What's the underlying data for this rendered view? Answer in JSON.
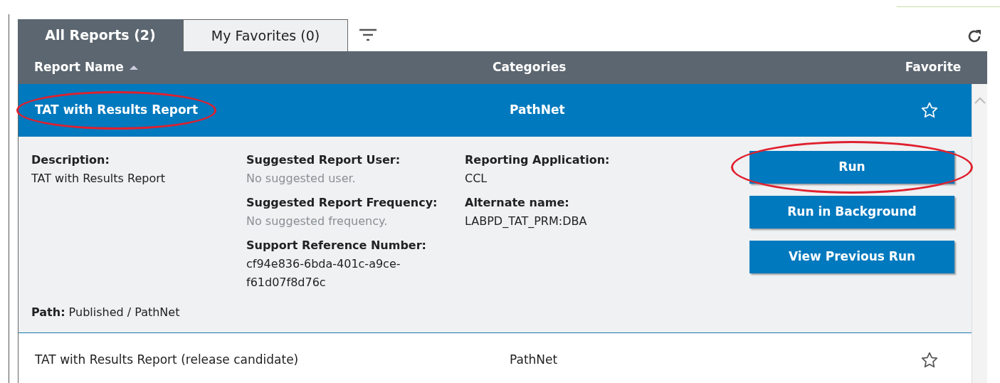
{
  "tabs": [
    {
      "label": "All Reports (2)",
      "selected": true
    },
    {
      "label": "My Favorites (0)",
      "selected": false
    }
  ],
  "table": {
    "columns": [
      {
        "label": "Report Name",
        "sorted_ascending": true
      },
      {
        "label": "Categories",
        "sorted_ascending": false
      },
      {
        "label": "Favorite",
        "sorted_ascending": false
      }
    ],
    "rows": [
      {
        "name": "TAT with Results Report",
        "category": "PathNet",
        "favorite": false,
        "selected": true,
        "expanded": true,
        "circled": true,
        "details": {
          "columns": [
            [
              {
                "label": "Description:",
                "value": "TAT with Results Report",
                "muted": false
              }
            ],
            [
              {
                "label": "Suggested Report User:",
                "value": "No suggested user.",
                "muted": true
              },
              {
                "label": "Suggested Report Frequency:",
                "value": "No suggested frequency.",
                "muted": true
              },
              {
                "label": "Support Reference Number:",
                "value": "cf94e836-6bda-401c-a9ce-f61d07f8d76c",
                "muted": false
              }
            ],
            [
              {
                "label": "Reporting Application:",
                "value": "CCL",
                "muted": false
              },
              {
                "label": "Alternate name:",
                "value": "LABPD_TAT_PRM:DBA",
                "muted": false
              }
            ]
          ],
          "path": "**Path:** Published / PathNet",
          "buttons": [
            {
              "label": "Run",
              "circled": true
            },
            {
              "label": "Run in Background",
              "circled": false
            },
            {
              "label": "View Previous Run",
              "circled": false
            }
          ]
        }
      },
      {
        "name": "TAT with Results Report (release candidate)",
        "category": "PathNet",
        "favorite": false,
        "selected": false,
        "expanded": false,
        "circled": false
      }
    ]
  }
}
